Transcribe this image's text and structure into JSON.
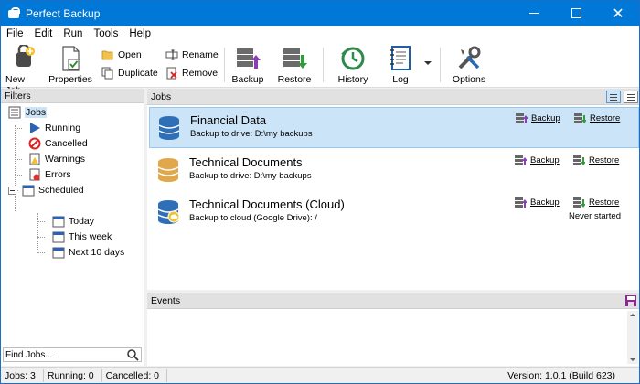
{
  "window": {
    "title": "Perfect Backup"
  },
  "menu": [
    "File",
    "Edit",
    "Run",
    "Tools",
    "Help"
  ],
  "toolbar": {
    "new_job": "New Job",
    "properties": "Properties",
    "open": "Open",
    "duplicate": "Duplicate",
    "rename": "Rename",
    "remove": "Remove",
    "backup": "Backup",
    "restore": "Restore",
    "history": "History",
    "log": "Log",
    "options": "Options"
  },
  "filters": {
    "header": "Filters",
    "tree": {
      "jobs": "Jobs",
      "running": "Running",
      "cancelled": "Cancelled",
      "warnings": "Warnings",
      "errors": "Errors",
      "scheduled": "Scheduled",
      "today": "Today",
      "this_week": "This week",
      "next_10_days": "Next 10 days"
    },
    "find_placeholder": "Find Jobs..."
  },
  "jobs": {
    "header": "Jobs",
    "items": [
      {
        "name": "Financial Data",
        "dest": "Backup to drive: D:\\my backups",
        "backup": "Backup",
        "restore": "Restore",
        "status": ""
      },
      {
        "name": "Technical Documents",
        "dest": "Backup to drive: D:\\my backups",
        "backup": "Backup",
        "restore": "Restore",
        "status": ""
      },
      {
        "name": "Technical Documents (Cloud)",
        "dest": "Backup to cloud (Google Drive): /",
        "backup": "Backup",
        "restore": "Restore",
        "status": "Never started"
      }
    ]
  },
  "events": {
    "header": "Events"
  },
  "status": {
    "jobs": "Jobs: 3",
    "running": "Running: 0",
    "cancelled": "Cancelled: 0",
    "version": "Version: 1.0.1 (Build 623)"
  },
  "colors": {
    "titlebar": "#0078d7",
    "selected": "#cce4f7",
    "db_blue": "#2f6fb7",
    "db_gold": "#e0a84a"
  }
}
